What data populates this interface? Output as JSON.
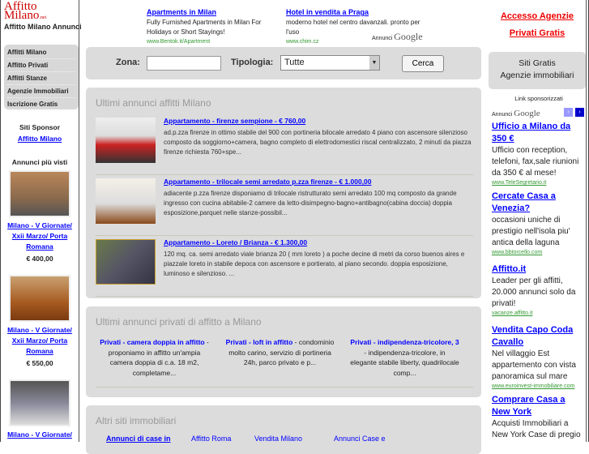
{
  "header": {
    "logo_text": "Affitto Milano",
    "site_title": "Affitto Milano Annunci",
    "ads": [
      {
        "title": "Apartments in Milan",
        "text": "Fully Furnished Apartments in Milan For Holidays or Short Stayings!",
        "url": "www.Bentok.it/Apartment"
      },
      {
        "title": "Hotel in vendita a Praga",
        "text": "moderno hotel nel centro davanzali. pronto per l'uso",
        "url": "www.chim.cz"
      }
    ],
    "ads_label": "Annunci",
    "ads_brand": "Google",
    "links": [
      "Accesso Agenzie",
      "Privati Gratis"
    ]
  },
  "left_menu": [
    "Affitti Milano",
    "Affitto Privati",
    "Affitti Stanze",
    "Agenzie Immobiliari",
    "Iscrizione Gratis"
  ],
  "sponsor": {
    "title": "Siti Sponsor",
    "link": "Affitto Milano"
  },
  "popular": {
    "title": "Annunci più visti",
    "items": [
      {
        "title": "Milano - V Giornate/ Xxii Marzo/ Porta Romana",
        "price": "€ 400,00"
      },
      {
        "title": "Milano - V Giornate/ Xxii Marzo/ Porta Romana",
        "price": "€ 550,00"
      },
      {
        "title": "Milano - V Giornate/",
        "price": ""
      }
    ]
  },
  "search": {
    "zona_label": "Zona:",
    "zona_value": "",
    "tipologia_label": "Tipologia:",
    "tipologia_value": "Tutte",
    "button": "Cerca"
  },
  "latest": {
    "title": "Ultimi annunci affitti Milano",
    "items": [
      {
        "title": "Appartamento - firenze sempione - € 760,00",
        "desc": "ad.p.zza firenze in ottimo stabile del 900 con portineria bilocale arredato 4 piano con ascensore silenzioso composto da soggiorno+camera, bagno completo di elettrodomestici riscal centralizzato, 2 minuti da piazza firenze richiesta 760+spe..."
      },
      {
        "title": "Appartamento - trilocale semi arredato p.zza firenze - € 1.000,00",
        "desc": "adiacente p.zza firenze disponiamo di trilocale ristrutturato semi arredato 100 mq composto da grande ingresso con cucina abitabile-2 camere da letto-disimpegno-bagno+antibagno(cabina doccia) doppia esposizione,parquet nelle stanze-possibil..."
      },
      {
        "title": "Appartamento - Loreto / Brianza - € 1.300,00",
        "desc": "120 mq. ca. semi arredato viale brianza 20 ( mm loreto ) a poche decine di metri da corso buenos aires e piazzale loreto in stabile depoca con ascensore e portierato, al piano secondo. doppia esposizione, luminoso e silenzioso. ..."
      }
    ]
  },
  "private": {
    "title": "Ultimi annunci privati di affitto a Milano",
    "items": [
      {
        "title": "Privati - camera doppia in affitto",
        "desc": " - proponiamo in affitto un'ampia camera doppia di c.a. 18 m2, completame..."
      },
      {
        "title": "Privati - loft in affitto",
        "desc": " - condominio molto carino, servizio di portineria 24h, parco privato e p..."
      },
      {
        "title": "Privati - indipendenza-tricolore, 3",
        "desc": " - indipendenza-tricolore, in elegante stabile liberty, quadrilocale comp..."
      }
    ]
  },
  "other": {
    "title": "Altri siti immobiliari",
    "links": [
      "Annunci di case in",
      "Affitto Roma",
      "Vendita Milano",
      "Annunci Case e"
    ]
  },
  "right": {
    "box": [
      "Siti Gratis",
      "Agenzie immobiliari"
    ],
    "sponsored": "Link sponsorizzati",
    "ads": [
      {
        "title": "Ufficio a Milano da 350 €",
        "text": "Ufficio con reception, telefoni, fax,sale riunioni da 350 € al mese!",
        "url": "www.TeleSegretario.it"
      },
      {
        "title": "Cercate Casa a Venezia?",
        "text": "occasioni uniche di prestigio nell'isola piu' antica della laguna",
        "url": "www.bbtorcello.com"
      },
      {
        "title": "Affitto.it",
        "text": "Leader per gli affitti, 20.000 annunci solo da privati!",
        "url": "vacanze.affitto.it"
      },
      {
        "title": "Vendita Capo Coda Cavallo",
        "text": "Nel villaggio Est appartemento con vista panoramica sul mare",
        "url": "www.euroinvest-immobiliare.com"
      },
      {
        "title": "Comprare Casa a New York",
        "text": "Acquisti Immobiliari a New York Case di pregio",
        "url": ""
      }
    ]
  }
}
